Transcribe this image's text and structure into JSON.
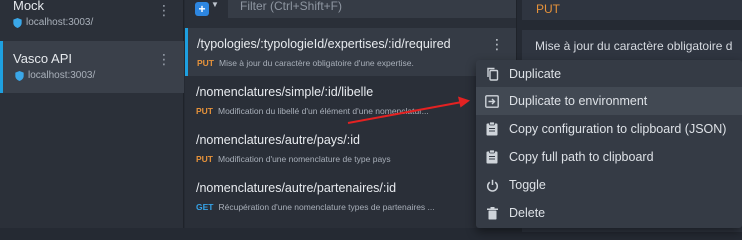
{
  "environments": [
    {
      "name": "Mock",
      "host": "localhost:3003/"
    },
    {
      "name": "Vasco API",
      "host": "localhost:3003/"
    }
  ],
  "toolbar": {
    "filter_placeholder": "Filter (Ctrl+Shift+F)"
  },
  "routes": [
    {
      "path": "/typologies/:typologieId/expertises/:id/required",
      "method": "PUT",
      "description": "Mise à jour du caractère obligatoire d'une expertise."
    },
    {
      "path": "/nomenclatures/simple/:id/libelle",
      "method": "PUT",
      "description": "Modification du libellé d'un élément d'une nomenclatur..."
    },
    {
      "path": "/nomenclatures/autre/pays/:id",
      "method": "PUT",
      "description": "Modification d'une nomenclature de type pays"
    },
    {
      "path": "/nomenclatures/autre/partenaires/:id",
      "method": "GET",
      "description": "Récupération d'une nomenclature types de partenaires ..."
    }
  ],
  "detail": {
    "method": "PUT",
    "description": "Mise à jour du caractère obligatoire d"
  },
  "context_menu": {
    "items": [
      {
        "label": "Duplicate",
        "icon": "copy-icon"
      },
      {
        "label": "Duplicate to environment",
        "icon": "move-to-icon"
      },
      {
        "label": "Copy configuration to clipboard (JSON)",
        "icon": "clipboard-icon"
      },
      {
        "label": "Copy full path to clipboard",
        "icon": "clipboard-icon"
      },
      {
        "label": "Toggle",
        "icon": "power-icon"
      },
      {
        "label": "Delete",
        "icon": "trash-icon"
      }
    ]
  },
  "colors": {
    "accent": "#1ea0e0",
    "put": "#e6923a",
    "get": "#35a3e8",
    "arrow": "#e32222"
  }
}
